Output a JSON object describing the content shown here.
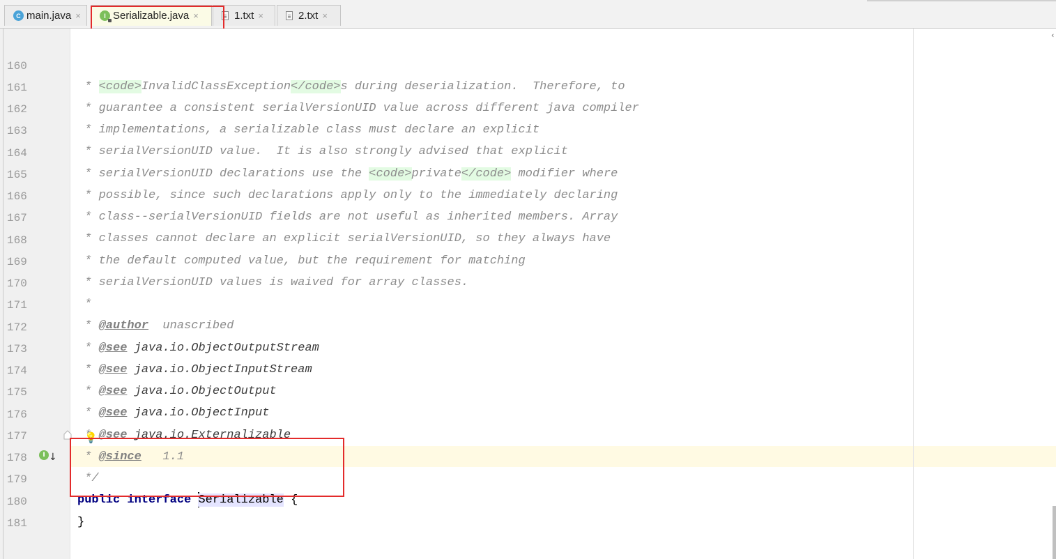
{
  "tabs": [
    {
      "label": "main.java",
      "icon": "class-icon"
    },
    {
      "label": "Serializable.java",
      "icon": "interface-icon"
    },
    {
      "label": "1.txt",
      "icon": "text-file-icon"
    },
    {
      "label": "2.txt",
      "icon": "text-file-icon"
    }
  ],
  "tab_close_glyph": "×",
  "lines": [
    {
      "n": "160"
    },
    {
      "n": "161"
    },
    {
      "n": "162"
    },
    {
      "n": "163"
    },
    {
      "n": "164"
    },
    {
      "n": "165"
    },
    {
      "n": "166"
    },
    {
      "n": "167"
    },
    {
      "n": "168"
    },
    {
      "n": "169"
    },
    {
      "n": "170"
    },
    {
      "n": "171"
    },
    {
      "n": "172"
    },
    {
      "n": "173"
    },
    {
      "n": "174"
    },
    {
      "n": "175"
    },
    {
      "n": "176"
    },
    {
      "n": "177"
    },
    {
      "n": "178"
    },
    {
      "n": "179"
    },
    {
      "n": "180"
    },
    {
      "n": "181"
    }
  ],
  "code": {
    "l160": {
      "pre": " * ",
      "tag1": "<code>",
      "mid": "InvalidClassException",
      "tag2": "</code>",
      "post": "s during deserialization.  Therefore, to"
    },
    "l161": " * guarantee a consistent serialVersionUID value across different java compiler",
    "l162": " * implementations, a serializable class must declare an explicit",
    "l163": " * serialVersionUID value.  It is also strongly advised that explicit",
    "l164": {
      "pre": " * serialVersionUID declarations use the ",
      "tag1": "<code>",
      "mid": "private",
      "tag2": "</code>",
      "post": " modifier where"
    },
    "l165": " * possible, since such declarations apply only to the immediately declaring",
    "l166": " * class--serialVersionUID fields are not useful as inherited members. Array",
    "l167": " * classes cannot declare an explicit serialVersionUID, so they always have",
    "l168": " * the default computed value, but the requirement for matching",
    "l169": " * serialVersionUID values is waived for array classes.",
    "l170": " *",
    "l171": {
      "star": " * ",
      "tag": "@author",
      "rest": "  unascribed"
    },
    "l172": {
      "star": " * ",
      "tag": "@see",
      "rest": " java.io.ObjectOutputStream"
    },
    "l173": {
      "star": " * ",
      "tag": "@see",
      "rest": " java.io.ObjectInputStream"
    },
    "l174": {
      "star": " * ",
      "tag": "@see",
      "rest": " java.io.ObjectOutput"
    },
    "l175": {
      "star": " * ",
      "tag": "@see",
      "rest": " java.io.ObjectInput"
    },
    "l176": {
      "star": " * ",
      "tag": "@see",
      "rest": " java.io.Externalizable"
    },
    "l177": {
      "star": " * ",
      "tag": "@since",
      "rest": "   1.1"
    },
    "l178": " */",
    "l179": {
      "kw1": "public",
      "kw2": "interface",
      "name": "Serializable",
      "brace": " {"
    },
    "l180": "}",
    "l181": ""
  },
  "colors": {
    "highlight_box": "#e32b2b",
    "keyword": "#000080",
    "doc_comment": "#8c8c8c",
    "caret_line": "#fffae3"
  }
}
